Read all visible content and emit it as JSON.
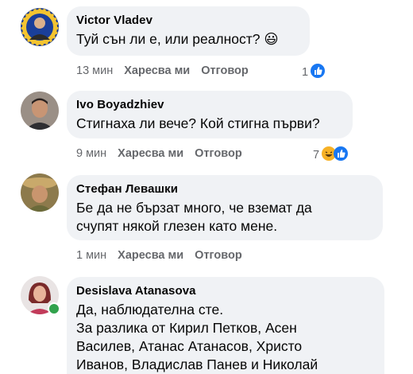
{
  "comments": [
    {
      "author": "Victor Vladev",
      "text": "Туй сън ли е, или реалност? 😃",
      "time": "13 мин",
      "like_label": "Харесва ми",
      "reply_label": "Отговор",
      "reaction_count": "1",
      "reactions": [
        "like"
      ]
    },
    {
      "author": "Ivo Boyadzhiev",
      "text": "Стигнаха ли вече? Кой стигна първи?",
      "time": "9 мин",
      "like_label": "Харесва ми",
      "reply_label": "Отговор",
      "reaction_count": "7",
      "reactions": [
        "haha",
        "like"
      ]
    },
    {
      "author": "Стефан Левашки",
      "text_lines": [
        "Бе да не бързат много, че вземат да",
        "счупят някой глезен като мене."
      ],
      "time": "1 мин",
      "like_label": "Харесва ми",
      "reply_label": "Отговор"
    },
    {
      "author": "Desislava Atanasova",
      "text_lines": [
        "Да, наблюдателна сте.",
        "За разлика от Кирил Петков, Асен",
        "Василев, Атанас Атанасов, Христо",
        "Иванов, Владислав Панев и Николай"
      ],
      "online": true
    }
  ],
  "colors": {
    "bubble": "#f0f2f5",
    "meta_text": "#65676b",
    "like_blue": "#1877f2",
    "haha_yellow": "#f7b125",
    "online_green": "#31a24c"
  }
}
